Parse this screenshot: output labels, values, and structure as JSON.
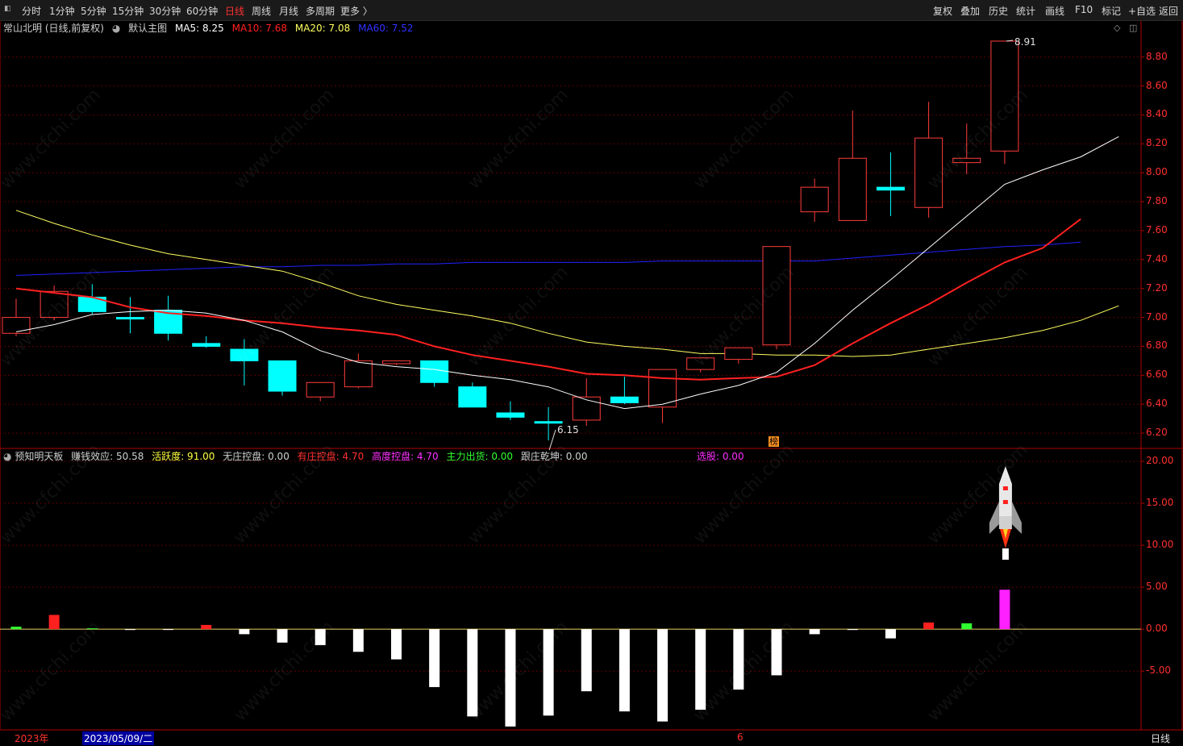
{
  "toolbar": {
    "periods": [
      "分时",
      "1分钟",
      "5分钟",
      "15分钟",
      "30分钟",
      "60分钟",
      "日线",
      "周线",
      "月线",
      "多周期",
      "更多 〉"
    ],
    "active_period": "日线",
    "right_buttons": [
      "复权",
      "叠加",
      "历史",
      "统计",
      "画线",
      "F10",
      "标记",
      "+自选",
      "返回"
    ]
  },
  "title": {
    "stock_name": "常山北明 (日线,前复权)",
    "template": "默认主图",
    "ma5": "MA5: 8.25",
    "ma10": "MA10: 7.68",
    "ma20": "MA20: 7.08",
    "ma60": "MA60: 7.52"
  },
  "indicator": {
    "name": "预知明天板",
    "earn": "赚钱效应: 50.58",
    "active": "活跃度: 91.00",
    "nozhuang": "无庄控盘: 0.00",
    "youzhuang": "有庄控盘: 4.70",
    "gaodu": "高度控盘: 4.70",
    "zhuli": "主力出货: 0.00",
    "genzhuang": "跟庄乾坤: 0.00",
    "xuangu": "选股: 0.00"
  },
  "annotations": {
    "high": "8.91",
    "low": "6.15",
    "bang": "榜"
  },
  "price_axis": [
    "8.80",
    "8.60",
    "8.40",
    "8.20",
    "8.00",
    "7.80",
    "7.60",
    "7.40",
    "7.20",
    "7.00",
    "6.80",
    "6.60",
    "6.40",
    "6.20"
  ],
  "ind_axis": [
    "20.00",
    "15.00",
    "10.00",
    "5.00",
    "0.00",
    "-5.00"
  ],
  "bottom": {
    "year": "2023年",
    "date": "2023/05/09/二",
    "month": "6",
    "period": "日线"
  },
  "watermark": "www.cfchi.com",
  "colors": {
    "up": "#ff3c3c",
    "down": "#00ffff",
    "ma5": "#ffffff",
    "ma10": "#ff2020",
    "ma20": "#ffff60",
    "ma60": "#2020ff"
  },
  "chart_data": {
    "type": "candlestick",
    "candles": [
      {
        "o": 6.89,
        "h": 7.13,
        "l": 6.87,
        "c": 7.0
      },
      {
        "o": 7.0,
        "h": 7.22,
        "l": 6.98,
        "c": 7.18
      },
      {
        "o": 7.14,
        "h": 7.23,
        "l": 7.02,
        "c": 7.04
      },
      {
        "o": 7.0,
        "h": 7.14,
        "l": 6.89,
        "c": 6.99
      },
      {
        "o": 7.05,
        "h": 7.15,
        "l": 6.84,
        "c": 6.89
      },
      {
        "o": 6.82,
        "h": 6.87,
        "l": 6.79,
        "c": 6.8
      },
      {
        "o": 6.78,
        "h": 6.85,
        "l": 6.53,
        "c": 6.7
      },
      {
        "o": 6.7,
        "h": 6.7,
        "l": 6.46,
        "c": 6.49
      },
      {
        "o": 6.45,
        "h": 6.55,
        "l": 6.42,
        "c": 6.55
      },
      {
        "o": 6.52,
        "h": 6.75,
        "l": 6.51,
        "c": 6.7
      },
      {
        "o": 6.68,
        "h": 6.7,
        "l": 6.67,
        "c": 6.7
      },
      {
        "o": 6.7,
        "h": 6.7,
        "l": 6.52,
        "c": 6.55
      },
      {
        "o": 6.52,
        "h": 6.55,
        "l": 6.38,
        "c": 6.38
      },
      {
        "o": 6.34,
        "h": 6.42,
        "l": 6.29,
        "c": 6.31
      },
      {
        "o": 6.28,
        "h": 6.38,
        "l": 6.15,
        "c": 6.27
      },
      {
        "o": 6.29,
        "h": 6.58,
        "l": 6.25,
        "c": 6.45
      },
      {
        "o": 6.45,
        "h": 6.59,
        "l": 6.4,
        "c": 6.41
      },
      {
        "o": 6.38,
        "h": 6.64,
        "l": 6.27,
        "c": 6.64
      },
      {
        "o": 6.64,
        "h": 6.72,
        "l": 6.62,
        "c": 6.72
      },
      {
        "o": 6.71,
        "h": 6.79,
        "l": 6.68,
        "c": 6.79
      },
      {
        "o": 6.81,
        "h": 7.49,
        "l": 6.78,
        "c": 7.49
      },
      {
        "o": 7.73,
        "h": 7.96,
        "l": 7.66,
        "c": 7.9
      },
      {
        "o": 7.67,
        "h": 8.43,
        "l": 7.67,
        "c": 8.1
      },
      {
        "o": 7.9,
        "h": 8.14,
        "l": 7.7,
        "c": 7.88
      },
      {
        "o": 7.76,
        "h": 8.49,
        "l": 7.69,
        "c": 8.24
      },
      {
        "o": 8.07,
        "h": 8.34,
        "l": 7.99,
        "c": 8.1
      },
      {
        "o": 8.15,
        "h": 8.91,
        "l": 8.06,
        "c": 8.91
      }
    ],
    "ma5": [
      6.9,
      6.95,
      7.02,
      7.04,
      7.05,
      7.03,
      6.98,
      6.9,
      6.77,
      6.69,
      6.66,
      6.64,
      6.6,
      6.57,
      6.52,
      6.43,
      6.37,
      6.4,
      6.47,
      6.53,
      6.62,
      6.82,
      7.05,
      7.26,
      7.48,
      7.7,
      7.92,
      8.02,
      8.11,
      8.25
    ],
    "ma10": [
      7.2,
      7.17,
      7.14,
      7.07,
      7.03,
      7.01,
      6.98,
      6.96,
      6.93,
      6.91,
      6.88,
      6.8,
      6.74,
      6.7,
      6.66,
      6.61,
      6.6,
      6.58,
      6.57,
      6.58,
      6.59,
      6.67,
      6.82,
      6.96,
      7.09,
      7.24,
      7.38,
      7.48,
      7.68
    ],
    "ma20": [
      7.74,
      7.65,
      7.57,
      7.5,
      7.44,
      7.4,
      7.36,
      7.32,
      7.24,
      7.15,
      7.09,
      7.05,
      7.01,
      6.96,
      6.89,
      6.83,
      6.8,
      6.78,
      6.75,
      6.75,
      6.74,
      6.74,
      6.73,
      6.74,
      6.78,
      6.82,
      6.86,
      6.91,
      6.98,
      7.08
    ],
    "ma60": [
      7.29,
      7.3,
      7.31,
      7.32,
      7.33,
      7.34,
      7.35,
      7.35,
      7.36,
      7.36,
      7.37,
      7.37,
      7.38,
      7.38,
      7.38,
      7.38,
      7.38,
      7.39,
      7.39,
      7.39,
      7.39,
      7.39,
      7.41,
      7.43,
      7.45,
      7.47,
      7.49,
      7.5,
      7.52
    ],
    "ind_bars": [
      0.3,
      1.7,
      0.1,
      -0.1,
      0,
      0.5,
      -0.6,
      -1.6,
      -1.9,
      -2.7,
      -3.6,
      -6.9,
      -10.4,
      -11.6,
      -10.3,
      -7.4,
      -9.8,
      -11.0,
      -9.6,
      -7.2,
      -5.5,
      -0.6,
      -0.1,
      -1.1,
      0.8,
      0.7,
      4.7
    ],
    "ylim": [
      6.1,
      8.96
    ],
    "ind_ylim": [
      -12.0,
      20.0
    ]
  }
}
